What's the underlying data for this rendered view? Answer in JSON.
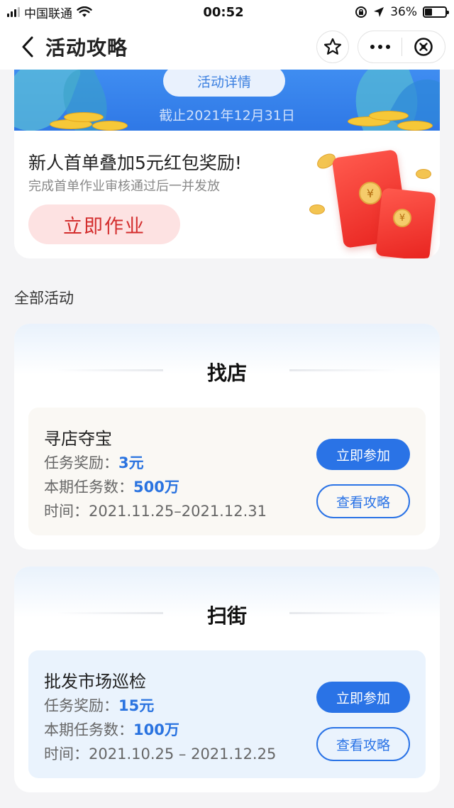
{
  "status_bar": {
    "carrier": "中国联通",
    "time": "00:52",
    "battery_percent": "36%",
    "battery_level": 0.36
  },
  "nav": {
    "title": "活动攻略"
  },
  "promo": {
    "detail_button": "活动详情",
    "deadline": "截止2021年12月31日",
    "title": "新人首单叠加5元红包奖励!",
    "subtitle": "完成首单作业审核通过后一并发放",
    "action_button": "立即作业",
    "seal_glyph": "¥"
  },
  "section_label": "全部活动",
  "activities": [
    {
      "category": "找店",
      "task_name": "寻店夺宝",
      "reward_label": "任务奖励：",
      "reward_value": "3元",
      "count_label": "本期任务数：",
      "count_value": "500万",
      "time_label": "时间：",
      "time_value": "2021.11.25–2021.12.31",
      "join_button": "立即参加",
      "guide_button": "查看攻略",
      "panel_color": "#faf8f4"
    },
    {
      "category": "扫街",
      "task_name": "批发市场巡检",
      "reward_label": "任务奖励：",
      "reward_value": "15元",
      "count_label": "本期任务数：",
      "count_value": "100万",
      "time_label": "时间：",
      "time_value": "2021.10.25 – 2021.12.25",
      "join_button": "立即参加",
      "guide_button": "查看攻略",
      "panel_color": "#eaf3fd"
    }
  ],
  "colors": {
    "accent": "#2a73e6",
    "promo_button_bg": "#fde2e2",
    "promo_button_text": "#d32d2d",
    "banner": "#3f8df1"
  },
  "icons": [
    "signal-icon",
    "wifi-icon",
    "lock-rotation-icon",
    "location-arrow-icon",
    "battery-icon",
    "back-chevron-icon",
    "star-icon",
    "more-icon",
    "close-circle-icon",
    "red-envelope-icon"
  ]
}
